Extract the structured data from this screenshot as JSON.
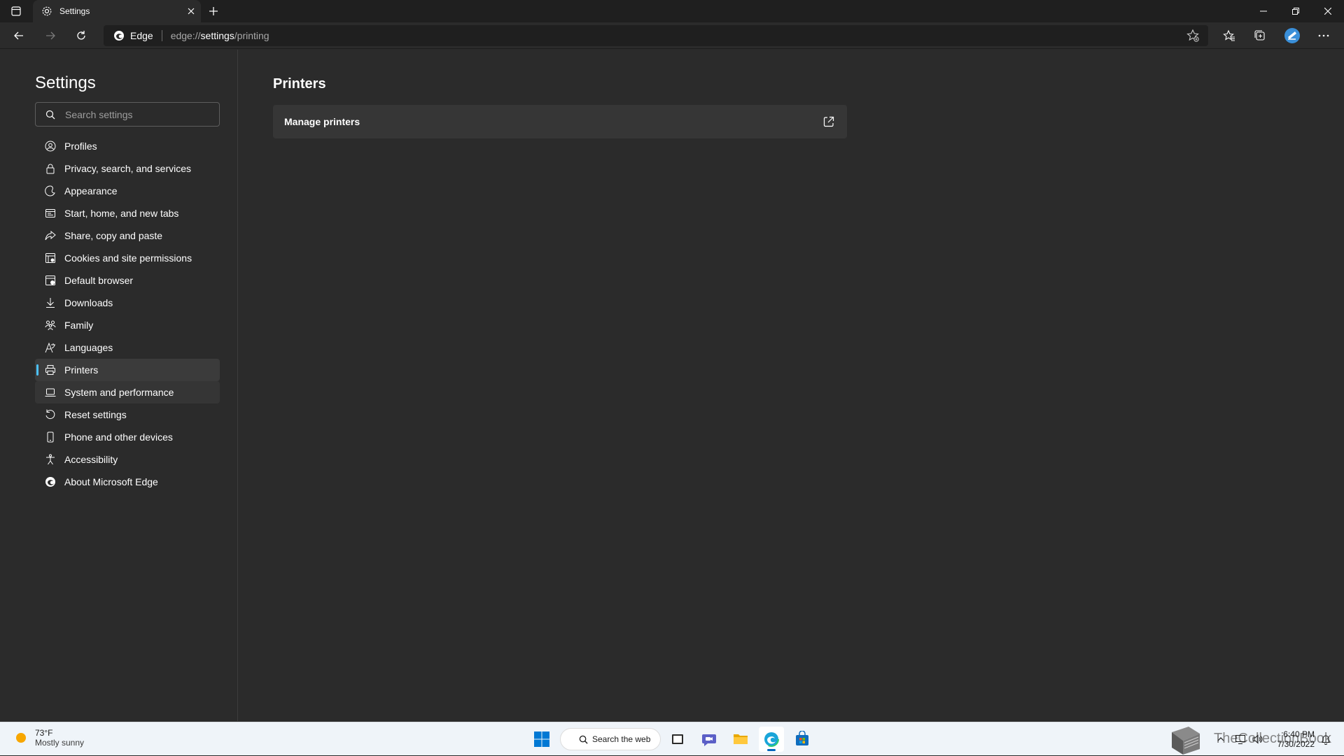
{
  "browser": {
    "tab_title": "Settings",
    "address_site_label": "Edge",
    "url_prefix": "edge://",
    "url_host": "settings",
    "url_path": "/printing"
  },
  "sidebar": {
    "title": "Settings",
    "search_placeholder": "Search settings",
    "items": [
      {
        "label": "Profiles",
        "icon": "profile-icon"
      },
      {
        "label": "Privacy, search, and services",
        "icon": "lock-icon"
      },
      {
        "label": "Appearance",
        "icon": "appearance-icon"
      },
      {
        "label": "Start, home, and new tabs",
        "icon": "start-page-icon"
      },
      {
        "label": "Share, copy and paste",
        "icon": "share-icon"
      },
      {
        "label": "Cookies and site permissions",
        "icon": "cookies-icon"
      },
      {
        "label": "Default browser",
        "icon": "browser-icon"
      },
      {
        "label": "Downloads",
        "icon": "download-icon"
      },
      {
        "label": "Family",
        "icon": "family-icon"
      },
      {
        "label": "Languages",
        "icon": "language-icon"
      },
      {
        "label": "Printers",
        "icon": "printer-icon",
        "active": true
      },
      {
        "label": "System and performance",
        "icon": "laptop-icon"
      },
      {
        "label": "Reset settings",
        "icon": "reset-icon"
      },
      {
        "label": "Phone and other devices",
        "icon": "phone-icon"
      },
      {
        "label": "Accessibility",
        "icon": "accessibility-icon"
      },
      {
        "label": "About Microsoft Edge",
        "icon": "edge-icon"
      }
    ]
  },
  "main": {
    "heading": "Printers",
    "manage_printers_label": "Manage printers"
  },
  "taskbar": {
    "weather_temp": "73°F",
    "weather_condition": "Mostly sunny",
    "search_label": "Search the web",
    "time": "6:40 PM",
    "date": "7/30/2022",
    "watermark": "TheCollectionBook"
  },
  "colors": {
    "accent": "#4cc2ff",
    "background": "#2b2b2b",
    "card": "#363636",
    "taskbar": "#eff4f9"
  }
}
